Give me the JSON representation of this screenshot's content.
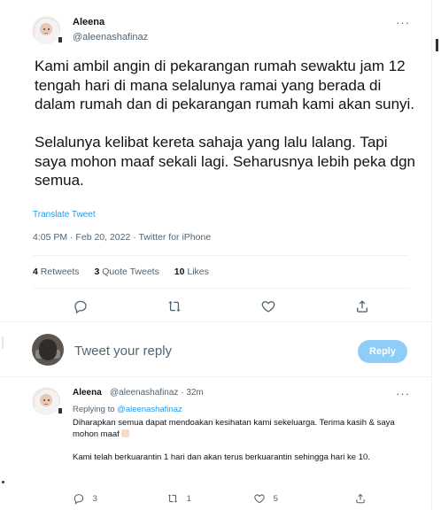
{
  "tweet": {
    "author_name": "Aleena",
    "author_handle": "@aleenashafinaz",
    "more": "···",
    "paragraphs": [
      "Kami ambil angin di pekarangan rumah sewaktu jam 12 tengah hari di mana selalunya ramai yang berada di dalam rumah dan di pekarangan rumah kami akan sunyi.",
      "Selalunya kelibat kereta sahaja yang lalu lalang. Tapi saya mohon maaf sekali lagi. Seharusnya lebih peka dgn semua."
    ],
    "translate_label": "Translate Tweet",
    "meta": "4:05 PM · Feb 20, 2022 · Twitter for iPhone",
    "stats": [
      {
        "count": "4",
        "label": "Retweets"
      },
      {
        "count": "3",
        "label": "Quote Tweets"
      },
      {
        "count": "10",
        "label": "Likes"
      }
    ],
    "action_icons": [
      "reply-icon",
      "retweet-icon",
      "like-icon",
      "share-icon"
    ]
  },
  "composer": {
    "placeholder": "Tweet your reply",
    "button_label": "Reply",
    "button_color": "#8ecdf8"
  },
  "reply": {
    "author_name": "Aleena",
    "author_handle": "@aleenashafinaz · 32m",
    "more": "···",
    "replying_prefix": "Replying to",
    "replying_handle": "@aleenashafinaz",
    "paragraphs": [
      "Diharapkan semua dapat mendoakan kesihatan kami sekeluarga. Terima kasih & saya mohon maaf",
      "Kami telah berkuarantin 1 hari dan akan terus berkuarantin sehingga hari ke 10."
    ],
    "emoji": "folded-hands-emoji",
    "reply_count": "3",
    "retweet_count": "1",
    "like_count": "5"
  },
  "colors": {
    "accent": "#1d9bf0",
    "secondary_text": "#536471",
    "divider": "#eff3f4"
  }
}
